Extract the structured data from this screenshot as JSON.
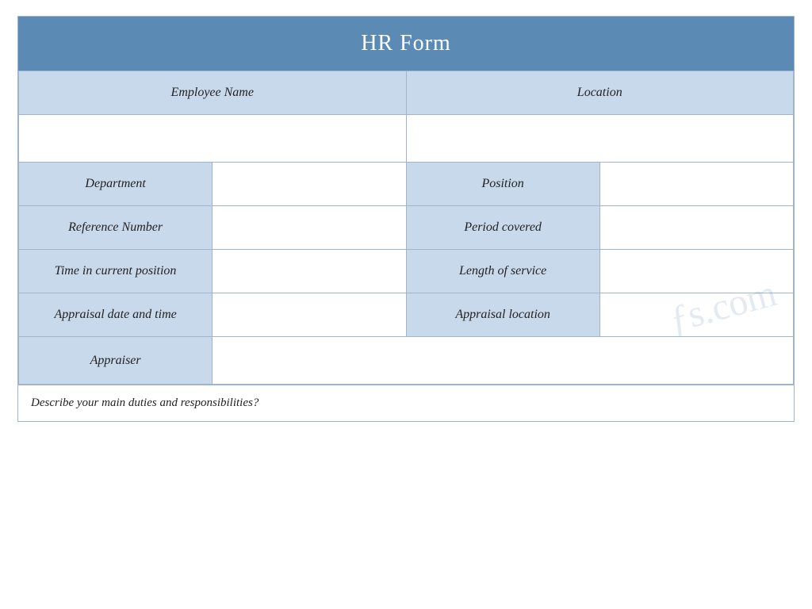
{
  "form": {
    "title": "HR Form",
    "rows": {
      "employee_name_label": "Employee Name",
      "location_label": "Location",
      "department_label": "Department",
      "position_label": "Position",
      "reference_number_label": "Reference Number",
      "period_covered_label": "Period covered",
      "time_in_current_position_label": "Time in current position",
      "length_of_service_label": "Length of service",
      "appraisal_date_label": "Appraisal date and time",
      "appraisal_location_label": "Appraisal location",
      "appraiser_label": "Appraiser",
      "bottom_question": "Describe your main duties and responsibilities?"
    }
  }
}
